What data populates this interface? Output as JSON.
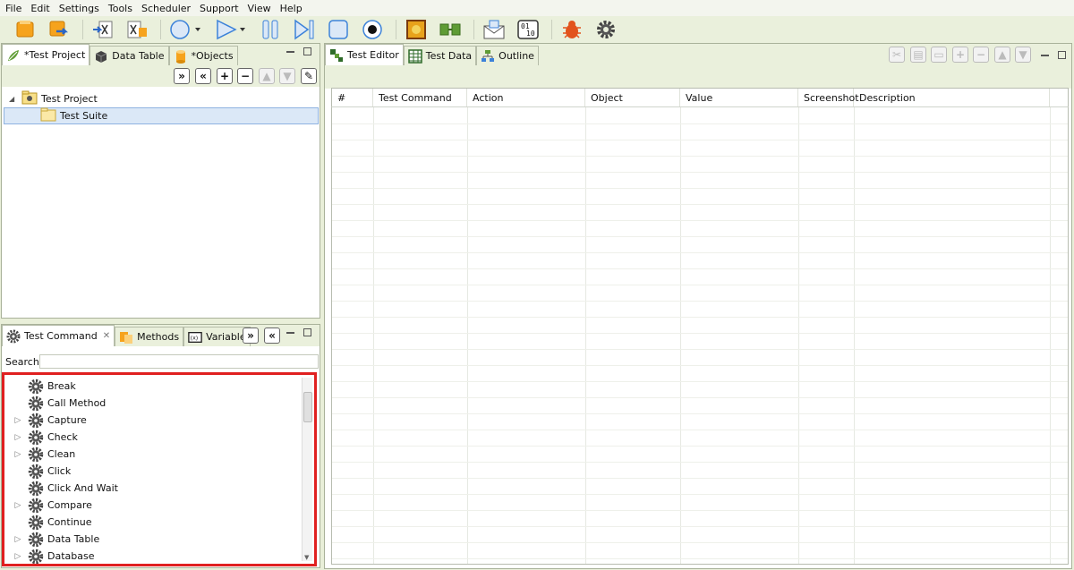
{
  "menu": [
    "File",
    "Edit",
    "Settings",
    "Tools",
    "Scheduler",
    "Support",
    "View",
    "Help"
  ],
  "toolbar": {
    "buttons": [
      "new-project-icon",
      "import-icon",
      "excel-export-icon",
      "excel-import-icon",
      "record-circle-icon",
      "play-icon",
      "pause-icon",
      "step-icon",
      "stop-icon",
      "record-icon",
      "image-icon",
      "data-flow-icon",
      "email-icon",
      "binary-icon",
      "bug-icon",
      "settings-gear-icon"
    ]
  },
  "project_panel": {
    "tabs": [
      "*Test Project",
      "Data Table",
      "*Objects"
    ],
    "tree": {
      "root": "Test Project",
      "child": "Test Suite"
    }
  },
  "command_panel": {
    "tabs": [
      "Test Command",
      "Methods",
      "Variable"
    ],
    "search_label": "Search",
    "search_value": "",
    "commands": [
      {
        "label": "Break",
        "expandable": false
      },
      {
        "label": "Call Method",
        "expandable": false
      },
      {
        "label": "Capture",
        "expandable": true
      },
      {
        "label": "Check",
        "expandable": true
      },
      {
        "label": "Clean",
        "expandable": true
      },
      {
        "label": "Click",
        "expandable": false
      },
      {
        "label": "Click And Wait",
        "expandable": false
      },
      {
        "label": "Compare",
        "expandable": true
      },
      {
        "label": "Continue",
        "expandable": false
      },
      {
        "label": "Data Table",
        "expandable": true
      },
      {
        "label": "Database",
        "expandable": true
      }
    ]
  },
  "editor_panel": {
    "tabs": [
      "Test Editor",
      "Test Data",
      "Outline"
    ],
    "columns": [
      "#",
      "Test Command",
      "Action",
      "Object",
      "Value",
      "Screenshot",
      "Description"
    ]
  },
  "colors": {
    "chrome_bg": "#eaf0dc",
    "highlight_border": "#e02020",
    "selection_bg": "#dbe8f7"
  }
}
